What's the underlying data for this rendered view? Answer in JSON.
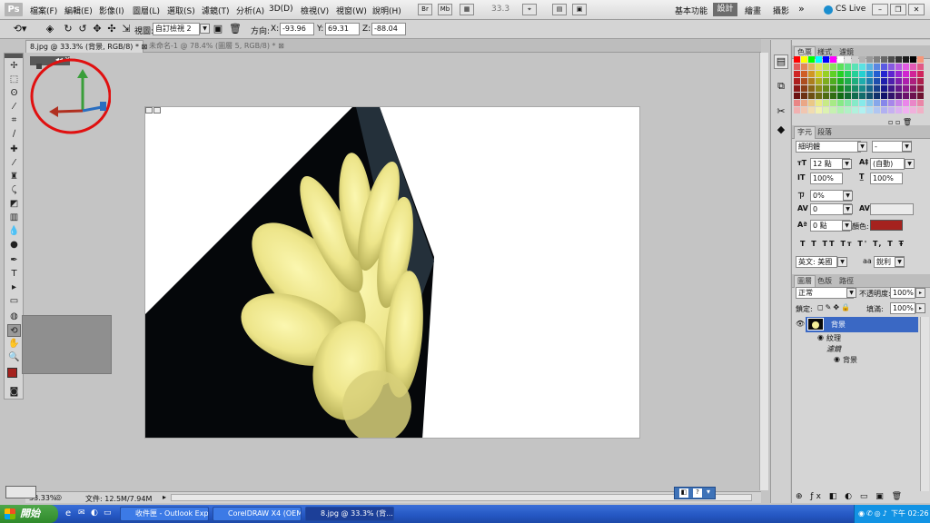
{
  "app": {
    "logo": "Ps"
  },
  "menu": [
    "檔案(F)",
    "編輯(E)",
    "影像(I)",
    "圖層(L)",
    "選取(S)",
    "濾鏡(T)",
    "分析(A)",
    "3D(D)",
    "檢視(V)",
    "視窗(W)",
    "說明(H)"
  ],
  "menu_buttons": [
    "Br",
    "Mb",
    "▦",
    "33.3",
    "⌖",
    "▤",
    "▣"
  ],
  "workspaces": {
    "basic": "基本功能",
    "active": "設計",
    "paint": "繪畫",
    "photo": "攝影",
    "more": "»",
    "cslive": "CS Live"
  },
  "options": {
    "view_label": "視圖:",
    "view_value": "自訂檢視 2",
    "direction_label": "方向:",
    "x_label": "X:",
    "x_value": "-93.96",
    "y_label": "Y:",
    "y_value": "69.31",
    "z_label": "Z:",
    "z_value": "-88.04"
  },
  "tabs": [
    "8.jpg @ 33.3% (背景, RGB/8) *",
    "未命名-1 @ 78.4% (圖層 5, RGB/8) *"
  ],
  "status": {
    "zoom": "33.33%",
    "doc": "文件: 12.5M/7.94M"
  },
  "panels": {
    "color_tabs": [
      "色票",
      "樣式",
      "濾鏡"
    ],
    "char_tabs": [
      "字元",
      "段落"
    ],
    "font_family": "細明體",
    "font_style": "-",
    "font_size": "12 點",
    "leading": "(自動)",
    "vscale": "100%",
    "hscale": "100%",
    "tracking_pct": "0%",
    "kerning": "0",
    "baseline": "0 點",
    "color_label": "顏色:",
    "text_color": "#a5221e",
    "type_styles": [
      "T",
      "T",
      "TT",
      "Tт",
      "T'",
      "T,",
      "T",
      "Ŧ"
    ],
    "language": "英文: 美國",
    "aa_label": "aa",
    "antialias": "銳利",
    "layer_tabs": [
      "圖層",
      "色版",
      "路徑"
    ],
    "blend_mode": "正常",
    "opacity_label": "不透明度:",
    "opacity": "100%",
    "lock_label": "鎖定:",
    "fill_label": "填滿:",
    "fill": "100%",
    "layers": [
      {
        "name": "背景",
        "type": "layer"
      },
      {
        "name": "紋理",
        "type": "effects"
      },
      {
        "name": "濾鏡",
        "type": "effect-group"
      },
      {
        "name": "背景",
        "type": "effect-item"
      }
    ]
  },
  "taskbar": {
    "start": "開始",
    "tasks": [
      "收件匣 - Outlook Exp...",
      "CorelDRAW X4 (OEM ...",
      "8.jpg @ 33.3% (背..."
    ],
    "clock": "下午 02:26"
  },
  "colors": {
    "accent": "#2a5fbf",
    "layer_selected": "#3a68c4",
    "fg_color": "#a5221e",
    "highlight_circle": "#e01010"
  }
}
